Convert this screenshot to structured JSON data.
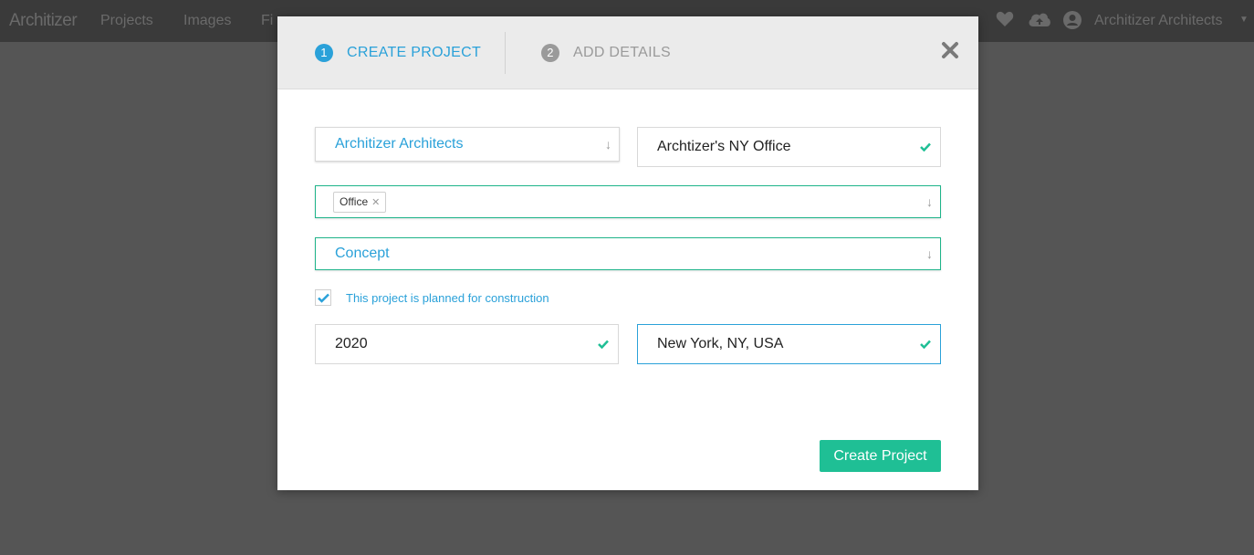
{
  "topbar": {
    "logo": "Architizer",
    "nav": [
      "Projects",
      "Images",
      "Fi"
    ],
    "icons": [
      "heart-icon",
      "cloud-upload-icon",
      "user-icon"
    ],
    "account_name": "Architizer Architects"
  },
  "modal": {
    "steps": [
      {
        "number": "1",
        "label": "CREATE PROJECT",
        "active": true
      },
      {
        "number": "2",
        "label": "ADD DETAILS",
        "active": false
      }
    ],
    "close_icon": "close-icon",
    "firm_select": {
      "value": "Architizer Architects"
    },
    "project_name": {
      "value": "Archtizer's NY Office",
      "valid": true
    },
    "typology": {
      "tags": [
        "Office"
      ]
    },
    "status_select": {
      "value": "Concept"
    },
    "construction_checkbox": {
      "checked": true,
      "label": "This project is planned for construction"
    },
    "year": {
      "value": "2020",
      "valid": true
    },
    "location": {
      "value": "New York, NY, USA",
      "valid": true
    },
    "submit_label": "Create Project"
  },
  "colors": {
    "accent_blue": "#2aa1d9",
    "accent_green": "#1fbf95",
    "overlay": "#555555"
  }
}
